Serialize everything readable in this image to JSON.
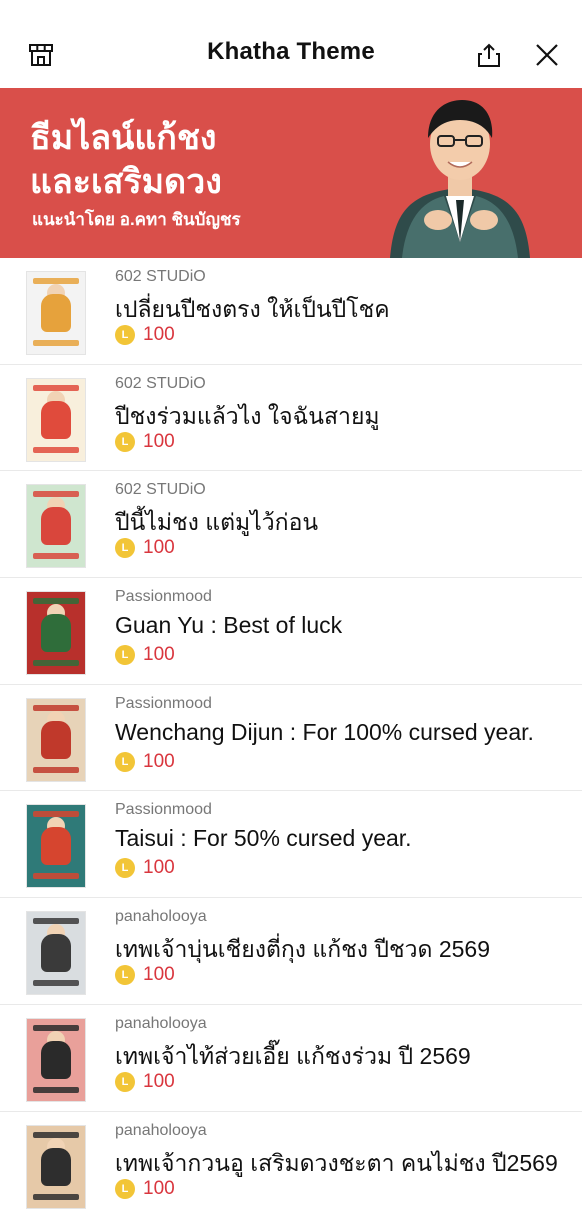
{
  "header": {
    "title": "Khatha Theme",
    "icons": {
      "store": "store-icon",
      "share": "share-icon",
      "close": "close-icon"
    }
  },
  "banner": {
    "line1": "ธีมไลน์แก้ชง",
    "line2": "และเสริมดวง",
    "line3": "แนะนำโดย อ.คทา ชินบัญชร",
    "background": "#d94f4a"
  },
  "coin_symbol": "L",
  "items": [
    {
      "creator": "602 STUDiO",
      "name": "เปลี่ยนปีชงตรง ให้เป็นปีโชค",
      "price": "100",
      "thumb_bg": "#f3f3f3",
      "accent": "#e6a23c"
    },
    {
      "creator": "602 STUDiO",
      "name": "ปีชงร่วมแล้วไง ใจฉันสายมู",
      "price": "100",
      "thumb_bg": "#f8efdc",
      "accent": "#e04b3c"
    },
    {
      "creator": "602 STUDiO",
      "name": "ปีนี้ไม่ชง แต่มูไว้ก่อน",
      "price": "100",
      "thumb_bg": "#cfe6cf",
      "accent": "#d9463c"
    },
    {
      "creator": "Passionmood",
      "name": "Guan Yu : Best of luck",
      "price": "100",
      "thumb_bg": "#b8302c",
      "accent": "#2f6d3a"
    },
    {
      "creator": "Passionmood",
      "name": "Wenchang Dijun : For 100% cursed year.",
      "price": "100",
      "thumb_bg": "#e7d3b8",
      "accent": "#c0392b"
    },
    {
      "creator": "Passionmood",
      "name": "Taisui : For 50% cursed year.",
      "price": "100",
      "thumb_bg": "#2f7a78",
      "accent": "#d6452f"
    },
    {
      "creator": "panaholooya",
      "name": "เทพเจ้าบุ่นเชียงตี่กุง แก้ชง ปีชวด 2569",
      "price": "100",
      "thumb_bg": "#d9dde0",
      "accent": "#3a3a3a"
    },
    {
      "creator": "panaholooya",
      "name": "เทพเจ้าไท้ส่วยเอี๊ย แก้ชงร่วม ปี 2569",
      "price": "100",
      "thumb_bg": "#e9a09a",
      "accent": "#2a2a2a"
    },
    {
      "creator": "panaholooya",
      "name": "เทพเจ้ากวนอู เสริมดวงชะตา คนไม่ชง ปี2569",
      "price": "100",
      "thumb_bg": "#e6c9a8",
      "accent": "#2e2e2e"
    }
  ]
}
